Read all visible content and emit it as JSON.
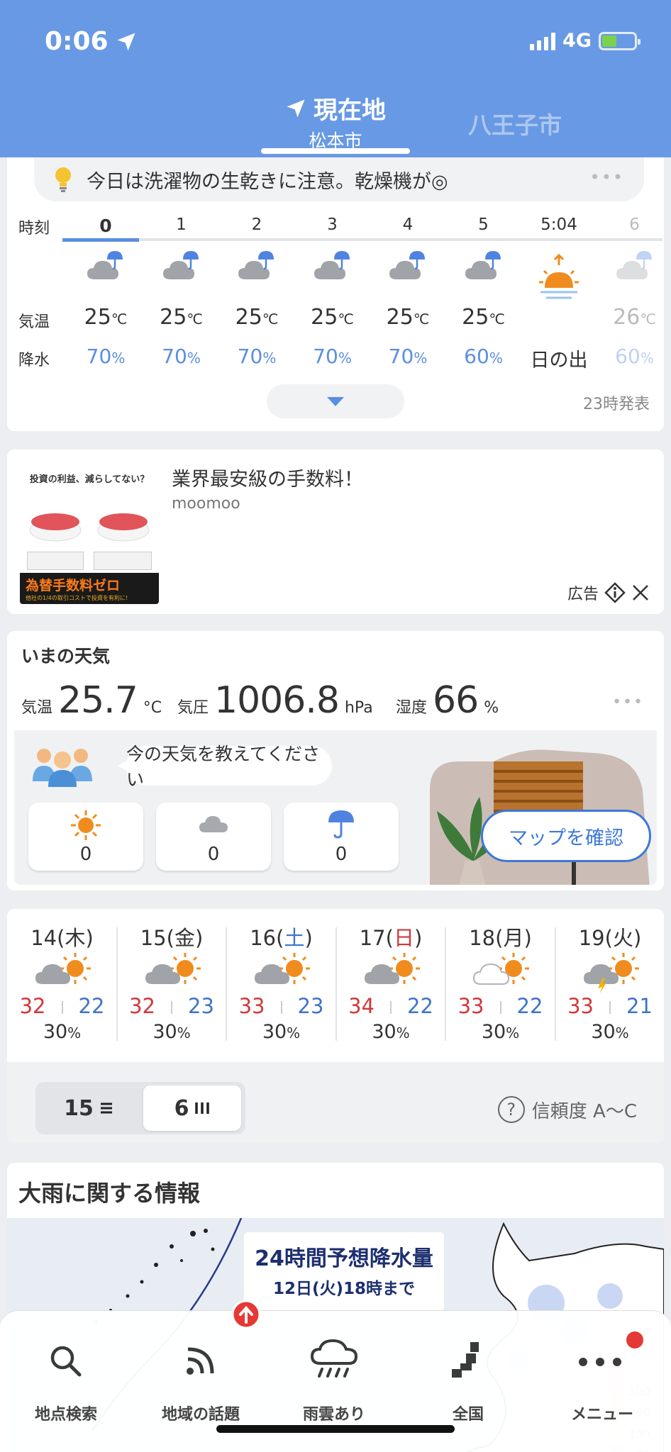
{
  "status_bar": {
    "time": "0:06",
    "network": "4G"
  },
  "header": {
    "tabs": [
      {
        "label": "現在地",
        "sub": "松本市",
        "active": true
      },
      {
        "label": "八王子市",
        "active": false
      }
    ]
  },
  "tip": {
    "text": "今日は洗濯物の生乾きに注意。乾燥機が◎",
    "more": "•••"
  },
  "hourly": {
    "labels": {
      "time": "時刻",
      "temp": "気温",
      "precip": "降水"
    },
    "columns": [
      {
        "hour": "0",
        "temp": "25",
        "precip": "70",
        "icon": "cloud-umbrella-icon"
      },
      {
        "hour": "1",
        "temp": "25",
        "precip": "70",
        "icon": "cloud-umbrella-icon"
      },
      {
        "hour": "2",
        "temp": "25",
        "precip": "70",
        "icon": "cloud-umbrella-icon"
      },
      {
        "hour": "3",
        "temp": "25",
        "precip": "70",
        "icon": "cloud-umbrella-icon"
      },
      {
        "hour": "4",
        "temp": "25",
        "precip": "70",
        "icon": "cloud-umbrella-icon"
      },
      {
        "hour": "5",
        "temp": "25",
        "precip": "60",
        "icon": "cloud-umbrella-icon"
      },
      {
        "hour": "5:04",
        "event": "日の出",
        "icon": "sunrise-icon"
      },
      {
        "hour": "6",
        "temp": "26",
        "precip": "60",
        "icon": "cloud-umbrella-icon"
      }
    ],
    "temp_unit": "℃",
    "precip_unit": "%",
    "issued": "23時発表"
  },
  "ad": {
    "title": "業界最安級の手数料！",
    "brand": "moomoo",
    "label": "広告",
    "image_text": {
      "headline": "投資の利益、減らしてない？",
      "banner": "為替手数料ゼロ",
      "banner_sub": "他社の1/4の取引コストで投資を有利に!"
    }
  },
  "now": {
    "title": "いまの天気",
    "temp": {
      "label": "気温",
      "value": "25.7",
      "unit": "°C"
    },
    "pressure": {
      "label": "気圧",
      "value": "1006.8",
      "unit": "hPa"
    },
    "humidity": {
      "label": "湿度",
      "value": "66",
      "unit": "%"
    },
    "more": "•••",
    "report_prompt": "今の天気を教えてください",
    "votes": [
      {
        "icon": "sun-icon",
        "count": "0"
      },
      {
        "icon": "cloud-icon",
        "count": "0"
      },
      {
        "icon": "umbrella-icon",
        "count": "0"
      }
    ],
    "map_button": "マップを確認"
  },
  "weekly": {
    "days": [
      {
        "date": "14",
        "dow": "木",
        "hi": "32",
        "lo": "22",
        "precip": "30",
        "dow_color": "#333333",
        "icon": "cloud-sun-icon"
      },
      {
        "date": "15",
        "dow": "金",
        "hi": "32",
        "lo": "23",
        "precip": "30",
        "dow_color": "#333333",
        "icon": "cloud-sun-icon"
      },
      {
        "date": "16",
        "dow": "土",
        "hi": "33",
        "lo": "23",
        "precip": "30",
        "dow_color": "#3e74c9",
        "icon": "cloud-sun-icon"
      },
      {
        "date": "17",
        "dow": "日",
        "hi": "34",
        "lo": "22",
        "precip": "30",
        "dow_color": "#d2383a",
        "icon": "cloud-sun-icon"
      },
      {
        "date": "18",
        "dow": "月",
        "hi": "33",
        "lo": "22",
        "precip": "30",
        "dow_color": "#333333",
        "icon": "white-cloud-sun-icon"
      },
      {
        "date": "19",
        "dow": "火",
        "hi": "33",
        "lo": "21",
        "precip": "30",
        "dow_color": "#333333",
        "icon": "thunder-cloud-sun-icon"
      }
    ],
    "precip_unit": "%",
    "toggle": [
      {
        "label": "15",
        "active": false
      },
      {
        "label": "6",
        "active": true
      }
    ],
    "reliability": "信頼度 A～C"
  },
  "rain_info": {
    "title": "大雨に関する情報",
    "map_title": "24時間予想降水量",
    "map_sub": "12日(火)18時まで",
    "legend": [
      "300",
      "200",
      "100",
      "50"
    ]
  },
  "tabbar": {
    "items": [
      {
        "label": "地点検索",
        "icon": "search-icon"
      },
      {
        "label": "地域の話題",
        "icon": "rss-icon"
      },
      {
        "label": "雨雲あり",
        "icon": "rain-cloud-icon"
      },
      {
        "label": "全国",
        "icon": "japan-map-icon"
      },
      {
        "label": "メニュー",
        "icon": "menu-dots-icon"
      }
    ]
  },
  "colors": {
    "header": "#6899e4",
    "accent": "#5b8ee0",
    "high": "#d2383a",
    "low": "#3e74c9"
  }
}
